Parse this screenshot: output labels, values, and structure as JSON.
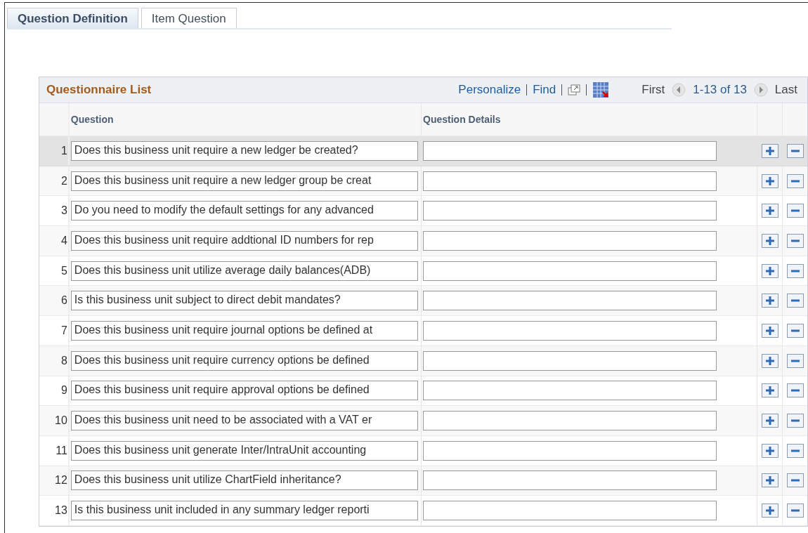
{
  "tabs": [
    {
      "label": "Question Definition",
      "selected": true
    },
    {
      "label": "Item Question",
      "selected": false
    }
  ],
  "grid": {
    "title": "Questionnaire List",
    "links": [
      "Personalize",
      "Find"
    ],
    "nav": {
      "first": "First",
      "range": "1-13 of 13",
      "last": "Last"
    },
    "columns": [
      "Question",
      "Question Details"
    ],
    "rows": [
      {
        "number": "1",
        "question": "Does this business unit require a new ledger be created?",
        "selected": true
      },
      {
        "number": "2",
        "question": "Does this business unit require a new ledger group be creat",
        "selected": false
      },
      {
        "number": "3",
        "question": "Do you need to modify the default settings for any advanced",
        "selected": false
      },
      {
        "number": "4",
        "question": "Does this business unit require addtional ID numbers for rep",
        "selected": false
      },
      {
        "number": "5",
        "question": "Does this business unit utilize average daily balances(ADB)",
        "selected": false
      },
      {
        "number": "6",
        "question": "Is this business unit subject to direct debit mandates?",
        "selected": false
      },
      {
        "number": "7",
        "question": "Does this business unit require journal options be defined at",
        "selected": false
      },
      {
        "number": "8",
        "question": "Does this business unit require currency options be defined",
        "selected": false
      },
      {
        "number": "9",
        "question": "Does this business unit require approval options be defined",
        "selected": false
      },
      {
        "number": "10",
        "question": "Does this business unit need to be associated with a VAT er",
        "selected": false
      },
      {
        "number": "11",
        "question": "Does this business unit generate Inter/IntraUnit accounting",
        "selected": false
      },
      {
        "number": "12",
        "question": "Does this business unit utilize ChartField inheritance?",
        "selected": false
      },
      {
        "number": "13",
        "question": "Is this business unit included in any summary ledger reporti",
        "selected": false
      }
    ]
  }
}
